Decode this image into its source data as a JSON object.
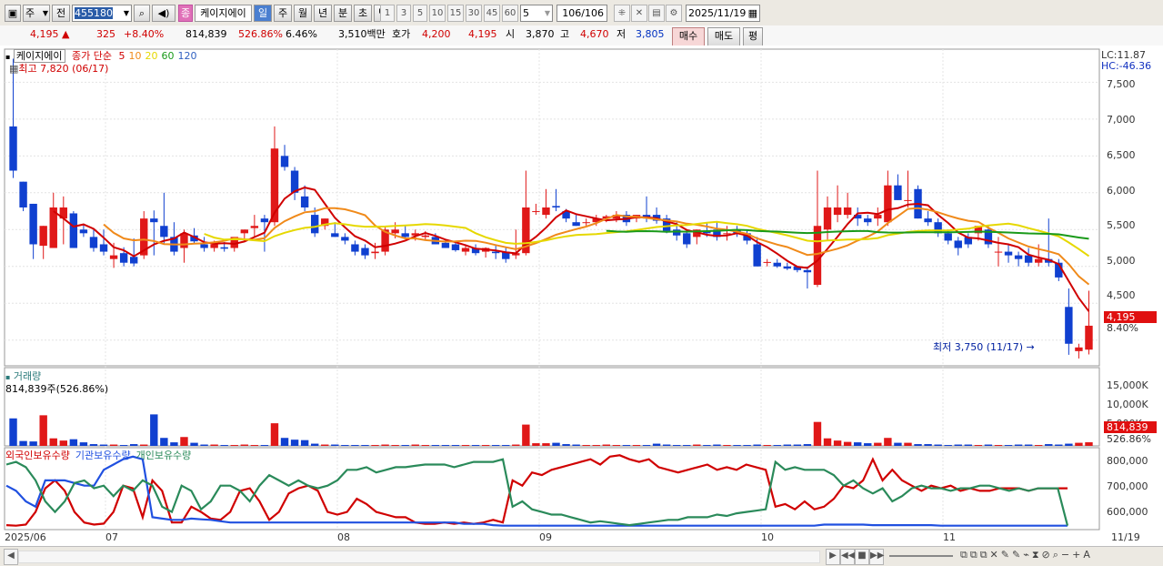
{
  "toolbar": {
    "period_main": "주",
    "market": "전",
    "code": "455180",
    "stock_name_tag": "종",
    "stock_name": "케이지에이",
    "periods": [
      "일",
      "주",
      "월",
      "년",
      "분",
      "초",
      "틱"
    ],
    "minute_options": [
      "1",
      "3",
      "5",
      "10",
      "15",
      "30",
      "45",
      "60"
    ],
    "count_select": "5",
    "page_counter": "106/106",
    "date": "2025/11/19"
  },
  "quote": {
    "price": "4,195",
    "change": "325",
    "change_pct": "+8.40%",
    "volume": "814,839",
    "volume_ratio": "526.86%",
    "turnover": "6.46%",
    "amount": "3,510백만",
    "ask_label": "호가",
    "ask_price": "4,200",
    "bid_price": "4,195",
    "open_label": "시",
    "open_price": "3,870",
    "high_label": "고",
    "high_price": "4,670",
    "low_label": "저",
    "low_price": "3,805",
    "buy_button": "매수",
    "sell_button": "매도",
    "eval_button": "평"
  },
  "price_pane": {
    "name": "케이지에이",
    "ma_label": "종가 단순",
    "ma_periods": [
      "5",
      "10",
      "20",
      "60",
      "120"
    ],
    "ma_colors": [
      "#d00000",
      "#f08a1a",
      "#e6d800",
      "#1a9a1a",
      "#3060c0"
    ],
    "high_note": "최고 7,820 (06/17)",
    "low_note": "최저 3,750 (11/17)",
    "lc": "LC:11.87",
    "hc": "HC:-46.36",
    "y_ticks": [
      "7,500",
      "7,000",
      "6,500",
      "6,000",
      "5,500",
      "5,000",
      "4,500"
    ],
    "last_price": "4,195",
    "last_pct": "8.40%"
  },
  "volume_pane": {
    "title": "거래량",
    "value": "814,839주(526.86%)",
    "y_ticks": [
      "15,000K",
      "10,000K",
      "5,000K"
    ],
    "last": "814,839",
    "last_pct": "526.86%"
  },
  "holdings_pane": {
    "legend": [
      "외국인보유수량",
      "기관보유수량",
      "개인보유수량"
    ],
    "legend_colors": [
      "#d00000",
      "#2050e0",
      "#2a8a5a"
    ],
    "y_ticks": [
      "800,000",
      "700,000",
      "600,000"
    ]
  },
  "x_axis": {
    "labels": [
      "2025/06",
      "07",
      "08",
      "09",
      "10",
      "11",
      "11/19"
    ]
  },
  "chart_data": {
    "type": "candlestick",
    "y_range": [
      3700,
      7900
    ],
    "candles": [
      [
        6900,
        7820,
        6200,
        6300
      ],
      [
        6150,
        6150,
        5750,
        5800
      ],
      [
        5850,
        5850,
        5100,
        5300
      ],
      [
        5280,
        5550,
        5100,
        5550
      ],
      [
        5250,
        6000,
        5250,
        5800
      ],
      [
        5650,
        5950,
        5300,
        5800
      ],
      [
        5720,
        5750,
        5250,
        5250
      ],
      [
        5500,
        5580,
        5400,
        5450
      ],
      [
        5400,
        5500,
        5200,
        5250
      ],
      [
        5300,
        5500,
        5150,
        5200
      ],
      [
        5100,
        5320,
        4980,
        5150
      ],
      [
        5180,
        5260,
        5000,
        5050
      ],
      [
        5130,
        5380,
        5000,
        5040
      ],
      [
        5150,
        5750,
        5100,
        5650
      ],
      [
        5650,
        5760,
        5150,
        5600
      ],
      [
        5550,
        6000,
        5300,
        5400
      ],
      [
        5400,
        5600,
        5150,
        5200
      ],
      [
        5250,
        5500,
        5050,
        5450
      ],
      [
        5420,
        5520,
        5300,
        5340
      ],
      [
        5300,
        5400,
        5200,
        5250
      ],
      [
        5250,
        5350,
        5200,
        5300
      ],
      [
        5260,
        5330,
        5200,
        5240
      ],
      [
        5250,
        5400,
        5200,
        5400
      ],
      [
        5450,
        5500,
        5330,
        5500
      ],
      [
        5520,
        5700,
        5400,
        5550
      ],
      [
        5650,
        5700,
        5200,
        5600
      ],
      [
        5600,
        6900,
        5550,
        6600
      ],
      [
        6500,
        6650,
        6300,
        6350
      ],
      [
        6300,
        6350,
        5900,
        6000
      ],
      [
        5950,
        6100,
        5750,
        5800
      ],
      [
        5700,
        5800,
        5400,
        5450
      ],
      [
        5550,
        5650,
        5500,
        5650
      ],
      [
        5450,
        5600,
        5400,
        5400
      ],
      [
        5400,
        5450,
        5300,
        5350
      ],
      [
        5300,
        5350,
        5150,
        5200
      ],
      [
        5250,
        5300,
        5100,
        5150
      ],
      [
        5180,
        5320,
        5100,
        5200
      ],
      [
        5200,
        5550,
        5150,
        5500
      ],
      [
        5450,
        5600,
        5380,
        5500
      ],
      [
        5450,
        5550,
        5380,
        5400
      ],
      [
        5420,
        5500,
        5350,
        5450
      ],
      [
        5400,
        5480,
        5350,
        5420
      ],
      [
        5400,
        5450,
        5300,
        5300
      ],
      [
        5320,
        5370,
        5250,
        5250
      ],
      [
        5300,
        5350,
        5200,
        5220
      ],
      [
        5200,
        5300,
        5150,
        5250
      ],
      [
        5250,
        5300,
        5150,
        5180
      ],
      [
        5200,
        5260,
        5120,
        5250
      ],
      [
        5200,
        5300,
        5100,
        5180
      ],
      [
        5200,
        5250,
        5050,
        5100
      ],
      [
        5150,
        5500,
        5100,
        5180
      ],
      [
        5180,
        6300,
        5150,
        5800
      ],
      [
        5750,
        5850,
        5700,
        5750
      ],
      [
        5700,
        6050,
        5650,
        5800
      ],
      [
        5820,
        6050,
        5750,
        5800
      ],
      [
        5750,
        5780,
        5600,
        5650
      ],
      [
        5600,
        5700,
        5550,
        5550
      ],
      [
        5600,
        5650,
        5550,
        5600
      ],
      [
        5600,
        5700,
        5550,
        5650
      ],
      [
        5650,
        5700,
        5600,
        5680
      ],
      [
        5650,
        5750,
        5600,
        5700
      ],
      [
        5700,
        5750,
        5550,
        5600
      ],
      [
        5650,
        5700,
        5600,
        5700
      ],
      [
        5700,
        5950,
        5600,
        5650
      ],
      [
        5700,
        5800,
        5580,
        5620
      ],
      [
        5650,
        5700,
        5450,
        5480
      ],
      [
        5500,
        5600,
        5350,
        5420
      ],
      [
        5450,
        5500,
        5250,
        5300
      ],
      [
        5400,
        5500,
        5300,
        5500
      ],
      [
        5480,
        5600,
        5400,
        5450
      ],
      [
        5500,
        5600,
        5350,
        5400
      ],
      [
        5450,
        5550,
        5350,
        5450
      ],
      [
        5500,
        5550,
        5400,
        5450
      ],
      [
        5450,
        5500,
        5300,
        5350
      ],
      [
        5300,
        5400,
        5000,
        5000
      ],
      [
        5050,
        5100,
        5000,
        5060
      ],
      [
        5050,
        5100,
        4980,
        5000
      ],
      [
        5000,
        5050,
        4950,
        4970
      ],
      [
        5000,
        5000,
        4920,
        4950
      ],
      [
        4950,
        5000,
        4700,
        4920
      ],
      [
        4750,
        6300,
        4720,
        5550
      ],
      [
        5500,
        5950,
        5350,
        5800
      ],
      [
        5700,
        6100,
        5600,
        5800
      ],
      [
        5700,
        6000,
        5650,
        5800
      ],
      [
        5700,
        5800,
        5550,
        5650
      ],
      [
        5650,
        5700,
        5550,
        5600
      ],
      [
        5650,
        5800,
        5550,
        5700
      ],
      [
        5600,
        6300,
        5550,
        6100
      ],
      [
        6100,
        6250,
        5900,
        5900
      ],
      [
        5900,
        6300,
        5800,
        5900
      ],
      [
        6050,
        6100,
        5650,
        5650
      ],
      [
        5650,
        5750,
        5550,
        5600
      ],
      [
        5600,
        5650,
        5400,
        5450
      ],
      [
        5450,
        5500,
        5300,
        5350
      ],
      [
        5350,
        5400,
        5150,
        5250
      ],
      [
        5400,
        5450,
        5250,
        5300
      ],
      [
        5450,
        5550,
        5350,
        5550
      ],
      [
        5500,
        5550,
        5250,
        5300
      ],
      [
        5200,
        5400,
        5000,
        5200
      ],
      [
        5200,
        5300,
        5050,
        5150
      ],
      [
        5150,
        5200,
        5000,
        5100
      ],
      [
        5150,
        5250,
        5000,
        5050
      ],
      [
        5050,
        5300,
        5000,
        5100
      ],
      [
        5100,
        5650,
        5000,
        5050
      ],
      [
        5050,
        5100,
        4800,
        4850
      ],
      [
        4450,
        4700,
        3800,
        3950
      ],
      [
        3850,
        3950,
        3750,
        3900
      ],
      [
        3870,
        4670,
        3805,
        4195
      ]
    ],
    "volumes": [
      6200,
      1100,
      1000,
      6900,
      1700,
      1200,
      1500,
      800,
      400,
      300,
      300,
      200,
      400,
      300,
      7100,
      1800,
      800,
      2000,
      700,
      300,
      300,
      200,
      200,
      300,
      200,
      200,
      5100,
      1800,
      1400,
      1300,
      500,
      300,
      300,
      200,
      200,
      200,
      200,
      300,
      200,
      200,
      300,
      200,
      200,
      200,
      200,
      200,
      200,
      200,
      200,
      200,
      300,
      4800,
      600,
      600,
      700,
      400,
      300,
      200,
      200,
      300,
      200,
      200,
      200,
      200,
      500,
      300,
      200,
      200,
      300,
      200,
      300,
      200,
      200,
      200,
      300,
      200,
      200,
      300,
      300,
      400,
      5400,
      1700,
      1200,
      900,
      800,
      600,
      700,
      1800,
      700,
      700,
      400,
      400,
      300,
      200,
      300,
      300,
      200,
      300,
      200,
      200,
      300,
      300,
      200,
      400,
      300,
      500,
      700,
      815
    ],
    "holdings": {
      "x_days": 110,
      "foreign": [
        550000,
        548000,
        552000,
        600000,
        690000,
        720000,
        680000,
        600000,
        560000,
        552000,
        556000,
        600000,
        700000,
        690000,
        580000,
        720000,
        680000,
        560000,
        560000,
        620000,
        600000,
        575000,
        570000,
        600000,
        680000,
        690000,
        640000,
        570000,
        600000,
        670000,
        690000,
        700000,
        680000,
        600000,
        590000,
        600000,
        650000,
        630000,
        600000,
        590000,
        580000,
        580000,
        560000,
        555000,
        555000,
        560000,
        555000,
        560000,
        555000,
        560000,
        570000,
        560000,
        720000,
        700000,
        750000,
        740000,
        760000,
        770000,
        780000,
        790000,
        800000,
        780000,
        810000,
        815000,
        800000,
        790000,
        800000,
        770000,
        760000,
        750000,
        760000,
        770000,
        780000,
        760000,
        770000,
        760000,
        780000,
        770000,
        760000,
        620000,
        630000,
        610000,
        640000,
        610000,
        620000,
        650000,
        700000,
        690000,
        720000,
        800000,
        720000,
        760000,
        720000,
        700000,
        680000,
        700000,
        690000,
        700000,
        680000,
        690000,
        680000,
        680000,
        690000,
        690000,
        690000,
        680000,
        690000,
        690000,
        690000,
        690000
      ],
      "institution": [
        700000,
        680000,
        640000,
        620000,
        720000,
        720000,
        720000,
        710000,
        700000,
        700000,
        760000,
        780000,
        800000,
        810000,
        800000,
        580000,
        575000,
        570000,
        570000,
        575000,
        572000,
        570000,
        565000,
        560000,
        560000,
        560000,
        560000,
        560000,
        560000,
        560000,
        560000,
        560000,
        560000,
        560000,
        560000,
        560000,
        560000,
        560000,
        560000,
        560000,
        560000,
        560000,
        560000,
        560000,
        560000,
        560000,
        560000,
        555000,
        555000,
        555000,
        550000,
        548000,
        548000,
        548000,
        548000,
        548000,
        548000,
        548000,
        548000,
        548000,
        548000,
        548000,
        548000,
        548000,
        548000,
        548000,
        548000,
        548000,
        548000,
        548000,
        548000,
        548000,
        548000,
        548000,
        548000,
        548000,
        548000,
        548000,
        548000,
        548000,
        548000,
        548000,
        548000,
        548000,
        552000,
        552000,
        552000,
        552000,
        552000,
        550000,
        550000,
        550000,
        550000,
        550000,
        550000,
        550000,
        548000,
        548000,
        548000,
        548000,
        548000,
        548000,
        548000,
        548000,
        548000,
        548000,
        548000,
        548000,
        548000,
        548000
      ],
      "individual": [
        780000,
        790000,
        770000,
        720000,
        640000,
        600000,
        640000,
        710000,
        720000,
        690000,
        700000,
        660000,
        700000,
        680000,
        720000,
        700000,
        620000,
        600000,
        700000,
        680000,
        610000,
        640000,
        700000,
        700000,
        680000,
        640000,
        700000,
        740000,
        720000,
        700000,
        720000,
        700000,
        690000,
        700000,
        720000,
        760000,
        760000,
        770000,
        750000,
        760000,
        770000,
        770000,
        775000,
        780000,
        780000,
        780000,
        770000,
        780000,
        790000,
        790000,
        790000,
        800000,
        620000,
        640000,
        610000,
        600000,
        590000,
        590000,
        580000,
        570000,
        560000,
        565000,
        560000,
        555000,
        550000,
        555000,
        560000,
        565000,
        570000,
        570000,
        580000,
        580000,
        580000,
        590000,
        585000,
        595000,
        600000,
        605000,
        610000,
        790000,
        760000,
        770000,
        760000,
        760000,
        760000,
        740000,
        700000,
        720000,
        690000,
        670000,
        690000,
        640000,
        660000,
        690000,
        700000,
        690000,
        690000,
        680000,
        690000,
        690000,
        700000,
        700000,
        690000,
        680000,
        690000,
        680000,
        690000,
        690000,
        690000,
        548000
      ]
    }
  }
}
